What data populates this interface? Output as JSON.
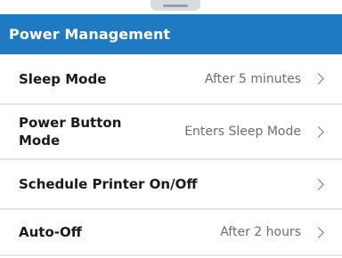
{
  "header": {
    "title": "Power Management"
  },
  "rows": [
    {
      "label": "Sleep Mode",
      "value": "After 5 minutes",
      "chevron": "chevron-right-icon"
    },
    {
      "label": "Power Button Mode",
      "value": "Enters Sleep Mode",
      "chevron": "chevron-right-icon"
    },
    {
      "label": "Schedule Printer On/Off",
      "value": "",
      "chevron": "chevron-right-icon"
    },
    {
      "label": "Auto-Off",
      "value": "After 2 hours",
      "chevron": "chevron-right-icon"
    }
  ],
  "colors": {
    "header_bg": "#1f7ac2",
    "header_text": "#ffffff",
    "label_text": "#1a1a1a",
    "value_text": "#6d6d6d",
    "divider": "#e3e6ea"
  }
}
